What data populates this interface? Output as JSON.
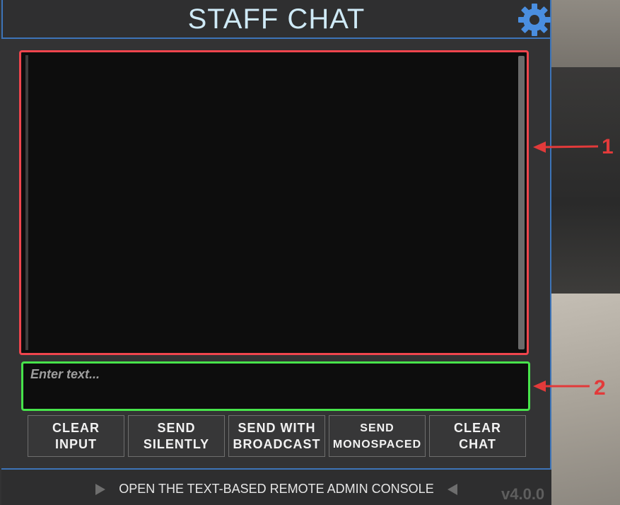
{
  "header": {
    "title": "STAFF CHAT",
    "settings_icon": "gear-icon"
  },
  "chat_log": {
    "content": ""
  },
  "input": {
    "placeholder": "Enter text...",
    "value": ""
  },
  "buttons": [
    {
      "label": "CLEAR\nINPUT"
    },
    {
      "label": "SEND\nSILENTLY"
    },
    {
      "label": "SEND WITH\nBROADCAST"
    },
    {
      "label": "SEND\nMONOSPACED"
    },
    {
      "label": "CLEAR\nCHAT"
    }
  ],
  "footer": {
    "link": "OPEN THE TEXT-BASED REMOTE ADMIN CONSOLE"
  },
  "version": "v4.0.0",
  "annotations": [
    {
      "label": "1"
    },
    {
      "label": "2"
    }
  ],
  "colors": {
    "accent": "#3d74b8",
    "title": "#cfeaf7",
    "annotation1": "#f0454d",
    "annotation2": "#47e34b"
  }
}
